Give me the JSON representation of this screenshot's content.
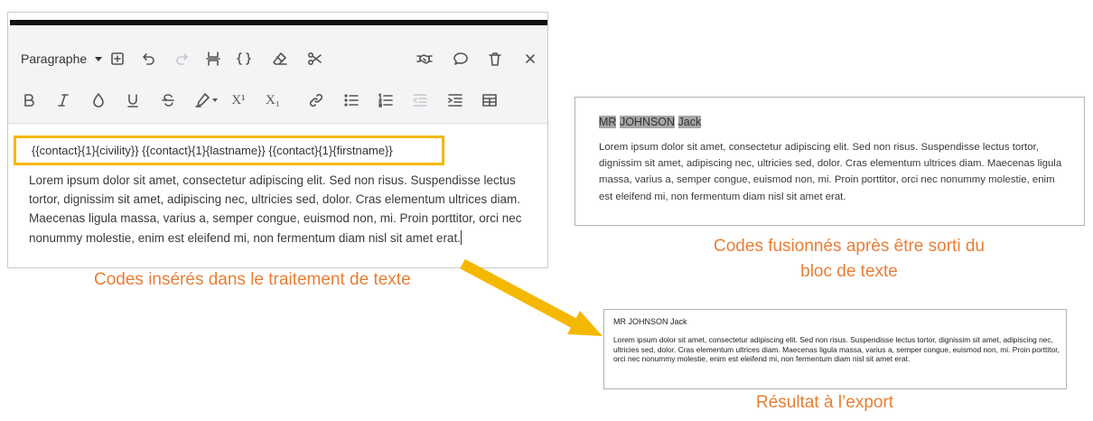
{
  "editor": {
    "toolbar": {
      "paragraph_label": "Paragraphe",
      "superscript_label": "X¹",
      "subscript_label": "X₁"
    },
    "codes_line": "{{contact}{1}{civility}} {{contact}{1}{lastname}} {{contact}{1}{firstname}}",
    "body": "Lorem ipsum dolor sit amet, consectetur adipiscing elit. Sed non risus. Suspendisse lectus tortor, dignissim sit amet, adipiscing nec, ultricies sed, dolor. Cras elementum ultrices diam. Maecenas ligula massa, varius a, semper congue, euismod non, mi. Proin porttitor, orci nec nonummy molestie, enim est eleifend mi, non fermentum diam nisl sit amet erat."
  },
  "captions": {
    "inserted": "Codes insérés dans le traitement de texte",
    "merged_line1": "Codes fusionnés après être sorti du",
    "merged_line2": "bloc de texte",
    "export": "Résultat à l’export"
  },
  "merged_preview": {
    "civility": "MR",
    "lastname": "JOHNSON",
    "firstname": "Jack",
    "body": "Lorem ipsum dolor sit amet, consectetur adipiscing elit. Sed non risus. Suspendisse lectus tortor, dignissim sit amet, adipiscing nec, ultricies sed, dolor. Cras elementum ultrices diam. Maecenas ligula massa, varius a, semper congue, euismod non, mi. Proin porttitor, orci nec nonummy molestie, enim est eleifend mi, non fermentum diam nisl sit amet erat."
  },
  "export_preview": {
    "name": "MR JOHNSON Jack",
    "body": "Lorem ipsum dolor sit amet, consectetur adipiscing elit. Sed non risus. Suspendisse lectus tortor, dignissim sit amet, adipiscing nec, ultricies sed, dolor. Cras elementum ultrices diam. Maecenas ligula massa, varius a, semper congue, euismod non, mi. Proin porttitor, orci nec nonummy molestie, enim est eleifend mi, non fermentum diam nisl sit amet erat."
  },
  "colors": {
    "highlight_box": "#f5b800",
    "caption_text": "#e87e34",
    "arrow": "#f5b800",
    "merged_highlight": "#a6a6a6"
  },
  "icons": {
    "toolbar_row1": [
      "add-block-icon",
      "undo-icon",
      "redo-icon",
      "page-break-icon",
      "code-braces-icon",
      "eraser-icon",
      "scissors-icon",
      "handshake-icon",
      "comment-icon",
      "trash-icon",
      "close-icon"
    ],
    "toolbar_row2": [
      "bold-icon",
      "italic-icon",
      "drop-icon",
      "underline-icon",
      "strikethrough-icon",
      "highlighter-icon",
      "superscript-icon",
      "subscript-icon",
      "link-icon",
      "bullet-list-icon",
      "numbered-list-icon",
      "outdent-icon",
      "indent-icon",
      "table-icon"
    ]
  }
}
